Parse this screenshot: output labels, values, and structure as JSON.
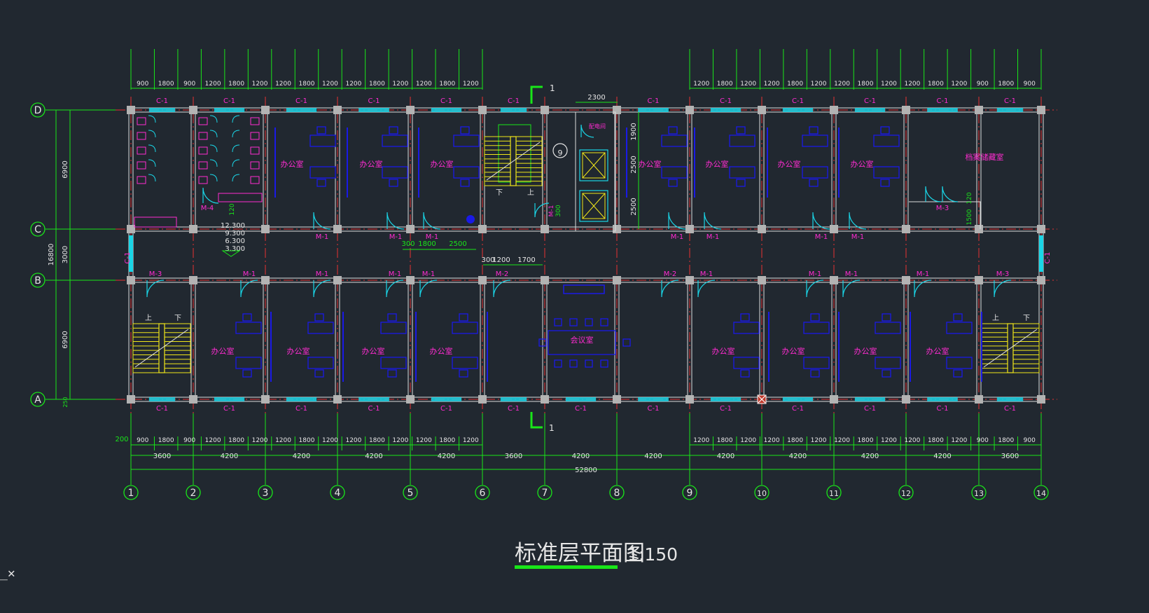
{
  "drawing": {
    "title": "标准层平面图",
    "scale": "1:150",
    "section_mark": "1",
    "ucs_icon": "_✕"
  },
  "colors": {
    "background": "#212830",
    "axis_green": "#19e619",
    "wall_red": "#e63232",
    "column_gray": "#b3b3b3",
    "window_cyan": "#1ad5e6",
    "text_magenta": "#ff2bd1",
    "furniture_blue": "#1a1ae6",
    "stair_yellow": "#f0e61a",
    "wall_white": "#dcdcdc"
  },
  "axes": {
    "columns": [
      "1",
      "2",
      "3",
      "4",
      "5",
      "6",
      "7",
      "8",
      "9",
      "10",
      "11",
      "12",
      "13",
      "14"
    ],
    "rows": [
      "D",
      "C",
      "B",
      "A"
    ],
    "bay_widths": [
      "3600",
      "4200",
      "4200",
      "4200",
      "4200",
      "3600",
      "4200",
      "4200",
      "4200",
      "4200",
      "4200",
      "4200",
      "3600"
    ],
    "total_length": "52800",
    "row_spans": [
      "6900",
      "3000",
      "6900"
    ],
    "total_depth": "16800",
    "bottom_offset": "250",
    "left_offset": "200"
  },
  "dim_top_left": [
    "900",
    "1800",
    "900",
    "1200",
    "1800",
    "1200",
    "1200",
    "1800",
    "1200",
    "1200",
    "1800",
    "1200",
    "1200",
    "1800",
    "1200"
  ],
  "dim_top_right": [
    "1200",
    "1800",
    "1200",
    "1200",
    "1800",
    "1200",
    "1200",
    "1800",
    "1200",
    "1200",
    "1800",
    "1200",
    "900",
    "1800",
    "900"
  ],
  "dim_bottom_left": [
    "900",
    "1800",
    "900",
    "1200",
    "1800",
    "1200",
    "1200",
    "1800",
    "1200",
    "1200",
    "1800",
    "1200",
    "1200",
    "1800",
    "1200"
  ],
  "dim_bottom_right": [
    "1200",
    "1800",
    "1200",
    "1200",
    "1800",
    "1200",
    "1200",
    "1800",
    "1200",
    "1200",
    "1800",
    "1200",
    "900",
    "1800",
    "900"
  ],
  "dim_core": {
    "elevator_width": "2300",
    "shaft_dims": [
      "1900",
      "2500",
      "2500"
    ],
    "stair_dims": [
      "300",
      "1200",
      "1700"
    ],
    "corridor_dims": [
      "300",
      "1800",
      "2500"
    ],
    "m1_offset": "300",
    "archive_dims": [
      "120",
      "1500"
    ],
    "toilet_dim": "120",
    "riser_symbol": "9"
  },
  "levels": [
    "12.300",
    "9.300",
    "6.300",
    "3.300"
  ],
  "labels": {
    "office": "办公室",
    "meeting": "会议室",
    "archive": "档案储藏室",
    "small_room": "配电间",
    "up": "上",
    "down": "下"
  },
  "windows": {
    "c1": "C-1"
  },
  "doors": {
    "m1": "M-1",
    "m2": "M-2",
    "m3": "M-3",
    "m4": "M-4"
  }
}
